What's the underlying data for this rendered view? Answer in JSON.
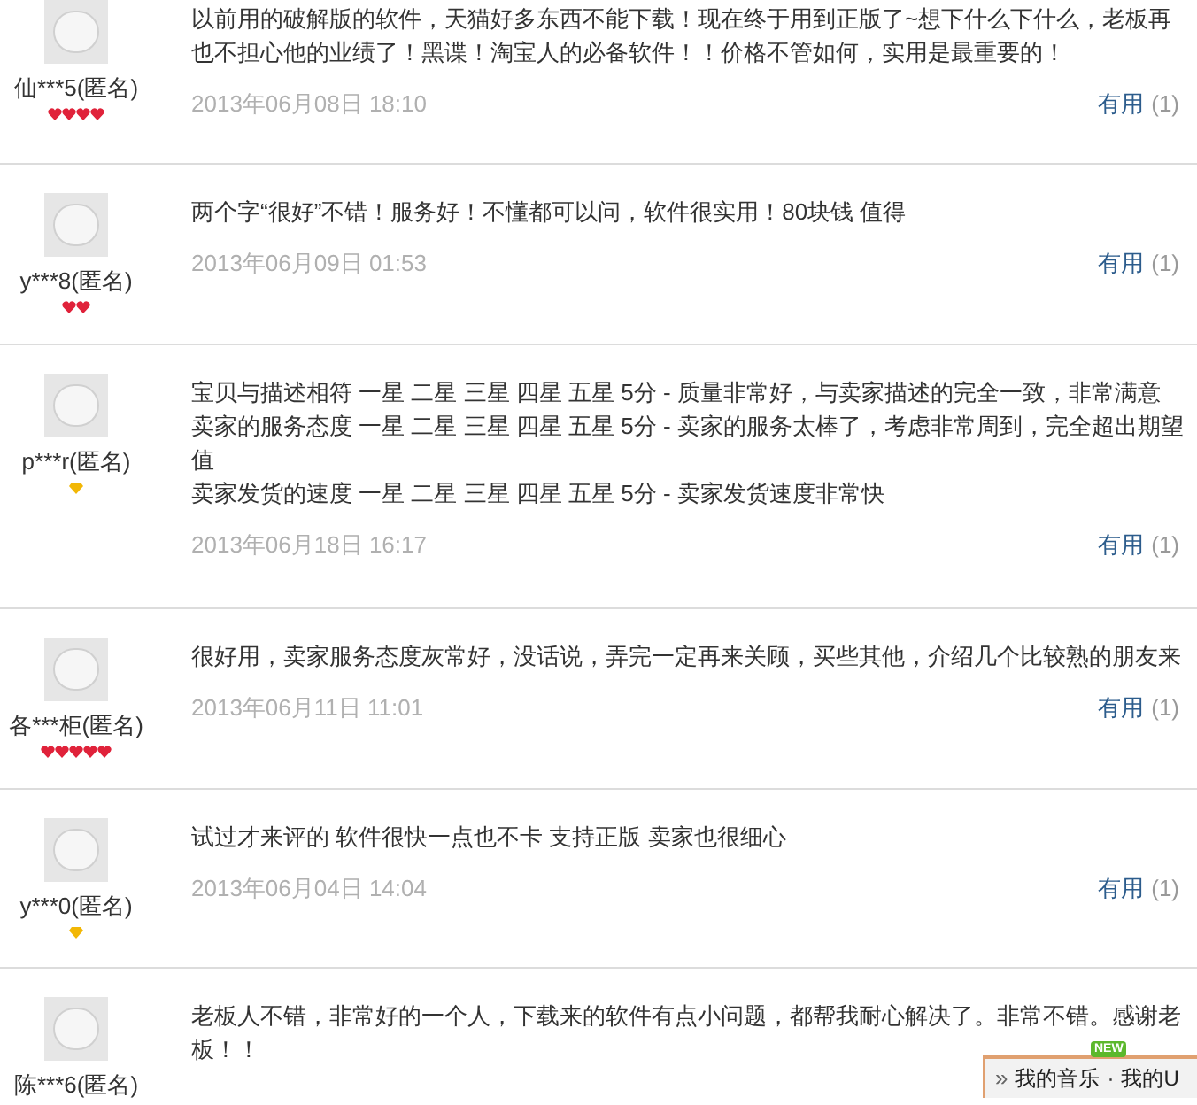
{
  "reviews": [
    {
      "user": "仙***5(匿名)",
      "rank_icons": [
        {
          "kind": "heart"
        },
        {
          "kind": "heart"
        },
        {
          "kind": "heart"
        },
        {
          "kind": "heart"
        }
      ],
      "lines": [
        "以前用的破解版的软件，天猫好多东西不能下载！现在终于用到正版了~想下什么下什么，老板再也不担心他的业绩了！黑谍！淘宝人的必备软件！！价格不管如何，实用是最重要的！"
      ],
      "date": "2013年06月08日 18:10",
      "helpful_label": "有用",
      "helpful_count": "(1)"
    },
    {
      "user": "y***8(匿名)",
      "rank_icons": [
        {
          "kind": "heart"
        },
        {
          "kind": "heart"
        }
      ],
      "lines": [
        "两个字“很好”不错！服务好！不懂都可以问，软件很实用！80块钱 值得"
      ],
      "date": "2013年06月09日 01:53",
      "helpful_label": "有用",
      "helpful_count": "(1)"
    },
    {
      "user": "p***r(匿名)",
      "rank_icons": [
        {
          "kind": "diamond"
        }
      ],
      "lines": [
        "宝贝与描述相符 一星 二星 三星 四星 五星 5分 - 质量非常好，与卖家描述的完全一致，非常满意",
        "卖家的服务态度 一星 二星 三星 四星 五星 5分 - 卖家的服务太棒了，考虑非常周到，完全超出期望值",
        "卖家发货的速度 一星 二星 三星 四星 五星 5分 - 卖家发货速度非常快"
      ],
      "date": "2013年06月18日 16:17",
      "helpful_label": "有用",
      "helpful_count": "(1)"
    },
    {
      "user": "各***柜(匿名)",
      "rank_icons": [
        {
          "kind": "heart"
        },
        {
          "kind": "heart"
        },
        {
          "kind": "heart"
        },
        {
          "kind": "heart"
        },
        {
          "kind": "heart"
        }
      ],
      "lines": [
        "很好用，卖家服务态度灰常好，没话说，弄完一定再来关顾，买些其他，介绍几个比较熟的朋友来"
      ],
      "date": "2013年06月11日 11:01",
      "helpful_label": "有用",
      "helpful_count": "(1)"
    },
    {
      "user": "y***0(匿名)",
      "rank_icons": [
        {
          "kind": "diamond"
        }
      ],
      "lines": [
        "试过才来评的 软件很快一点也不卡 支持正版 卖家也很细心"
      ],
      "date": "2013年06月04日 14:04",
      "helpful_label": "有用",
      "helpful_count": "(1)"
    },
    {
      "user": "陈***6(匿名)",
      "lines": [
        "老板人不错，非常好的一个人，下载来的软件有点小问题，都帮我耐心解决了。非常不错。感谢老",
        "板！！"
      ]
    }
  ],
  "music_bar": {
    "expand_icon": "»",
    "links": [
      "我的音乐",
      "我的U"
    ],
    "separator": "·",
    "badge": "NEW"
  }
}
